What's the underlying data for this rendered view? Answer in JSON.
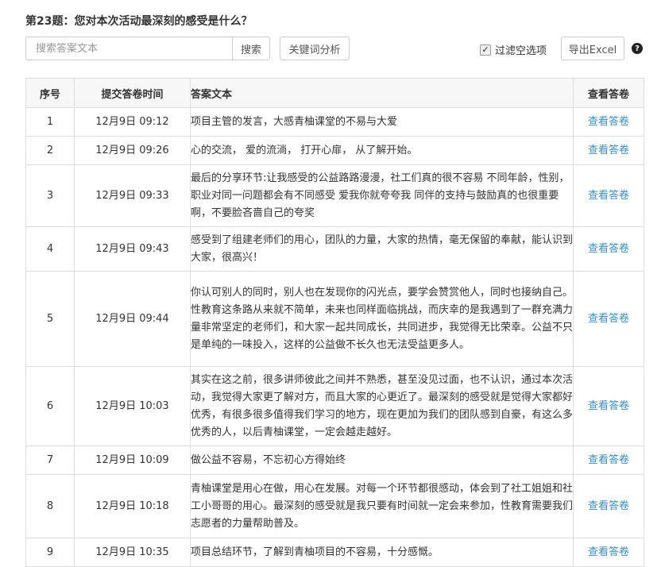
{
  "question": "第23题：您对本次活动最深刻的感受是什么？",
  "toolbar": {
    "search_placeholder": "搜索答案文本",
    "search_button": "搜索",
    "keyword_button": "关键词分析",
    "filter_label": "过滤空选项",
    "filter_checked": true,
    "export_button": "导出Excel",
    "help_icon": "?"
  },
  "table": {
    "headers": [
      "序号",
      "提交答卷时间",
      "答案文本",
      "查看答卷"
    ],
    "link_label": "查看答卷",
    "link_color": "#3c8dbc",
    "rows": [
      {
        "no": "1",
        "time": "12月9日 09:12",
        "text": "项目主管的发言，大感青柚课堂的不易与大爱"
      },
      {
        "no": "2",
        "time": "12月9日 09:26",
        "text": "心的交流， 爱的流淌， 打开心扉， 从了解开始。"
      },
      {
        "no": "3",
        "time": "12月9日 09:33",
        "text": "最后的分享环节:让我感受的公益路路漫漫，社工们真的很不容易 不同年龄，性别，职业对同一问题都会有不同感受 爱我你就夸夸我 同伴的支持与鼓励真的也很重要啊，不要脸吝啬自己的夸奖"
      },
      {
        "no": "4",
        "time": "12月9日 09:43",
        "text": "感受到了组建老师们的用心，团队的力量，大家的热情，毫无保留的奉献，能认识到大家，很高兴！"
      },
      {
        "no": "5",
        "time": "12月9日 09:44",
        "text": "你认可别人的同时，别人也在发现你的闪光点，要学会赞赏他人，同时也接纳自己。性教育这条路从来就不简单，未来也同样面临挑战，而庆幸的是我遇到了一群充满力量非常坚定的老师们，和大家一起共同成长，共同进步，我觉得无比荣幸。公益不只是单纯的一味投入，这样的公益做不长久也无法受益更多人。"
      },
      {
        "no": "6",
        "time": "12月9日 10:03",
        "text": "其实在这之前，很多讲师彼此之间并不熟悉，甚至没见过面，也不认识，通过本次活动，我觉得大家更了解对方，而且大家的心更近了。最深刻的感受就是觉得大家都好优秀，有很多很多值得我们学习的地方，现在更加为我们的团队感到自豪，有这么多优秀的人，以后青柚课堂，一定会越走越好。"
      },
      {
        "no": "7",
        "time": "12月9日 10:09",
        "text": "做公益不容易，不忘初心方得始终"
      },
      {
        "no": "8",
        "time": "12月9日 10:18",
        "text": "青柚课堂是用心在做，用心在发展。对每一个环节都很感动，体会到了社工姐姐和社工小哥哥的用心。最深刻的感受就是我只要有时间就一定会来参加，性教育需要我们志愿者的力量帮助普及。"
      },
      {
        "no": "9",
        "time": "12月9日 10:35",
        "text": "项目总结环节，了解到青柚项目的不容易，十分感慨。"
      }
    ]
  }
}
